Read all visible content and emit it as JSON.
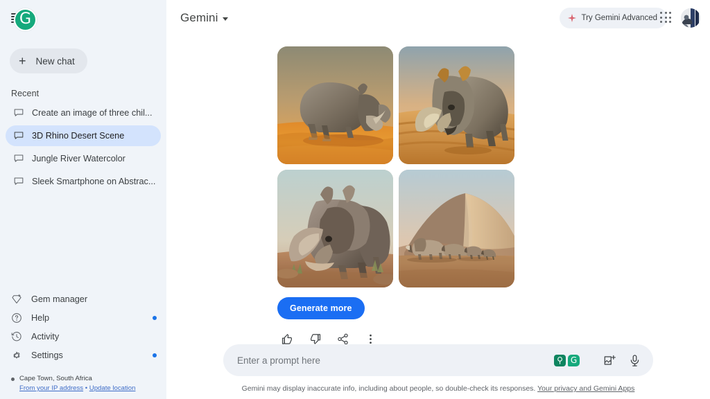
{
  "sidebar": {
    "logo_icon": "grammarly-logo-icon",
    "menu_icon": "hamburger-menu-icon",
    "new_chat": {
      "label": "New chat",
      "icon": "plus-icon"
    },
    "recent_label": "Recent",
    "chats": [
      {
        "label": "Create an image of three chil...",
        "icon": "chat-bubble-icon",
        "active": false
      },
      {
        "label": "3D Rhino Desert Scene",
        "icon": "chat-bubble-icon",
        "active": true
      },
      {
        "label": "Jungle River Watercolor",
        "icon": "chat-bubble-icon",
        "active": false
      },
      {
        "label": "Sleek Smartphone on Abstrac...",
        "icon": "chat-bubble-icon",
        "active": false
      }
    ],
    "nav": [
      {
        "label": "Gem manager",
        "icon": "gem-diamond-icon",
        "badge": false
      },
      {
        "label": "Help",
        "icon": "help-question-icon",
        "badge": true
      },
      {
        "label": "Activity",
        "icon": "history-clock-icon",
        "badge": false
      },
      {
        "label": "Settings",
        "icon": "gear-icon",
        "badge": true
      }
    ],
    "location": {
      "place": "Cape Town, South Africa",
      "source": "From your IP address",
      "separator": " • ",
      "update_link": "Update location"
    }
  },
  "header": {
    "title": "Gemini",
    "dropdown_icon": "chevron-down-icon",
    "advanced_pill": {
      "label": "Try Gemini Advanced",
      "icon": "sparkle-icon"
    },
    "apps_icon": "apps-grid-icon",
    "avatar": "user-avatar"
  },
  "main": {
    "images": [
      {
        "alt": "Rhino standing on orange desert dunes at sunset"
      },
      {
        "alt": "Close-up rhino charging over sand dunes"
      },
      {
        "alt": "Rhino grazing in rocky desert terrain"
      },
      {
        "alt": "Herd of rhinos walking past a large sand dune"
      }
    ],
    "generate_more_label": "Generate more",
    "actions": [
      {
        "name": "thumbs-up-icon",
        "label": "Good response"
      },
      {
        "name": "thumbs-down-icon",
        "label": "Bad response"
      },
      {
        "name": "share-icon",
        "label": "Share & export"
      },
      {
        "name": "more-options-icon",
        "label": "More"
      }
    ]
  },
  "composer": {
    "placeholder": "Enter a prompt here",
    "value": "",
    "grammarly_pin_icon": "grammarly-pin-icon",
    "grammarly_logo_icon": "grammarly-g-icon",
    "image_upload_icon": "add-image-icon",
    "mic_icon": "microphone-icon"
  },
  "footer": {
    "disclaimer": "Gemini may display inaccurate info, including about people, so double-check its responses.",
    "link": "Your privacy and Gemini Apps"
  },
  "colors": {
    "sidebar_bg": "#f0f4f9",
    "active_chat_bg": "#d3e3fd",
    "accent_blue": "#1b6ef3",
    "badge_blue": "#1a73e8",
    "grammarly_green": "#15a97c",
    "sparkle_pink": "#d96570"
  }
}
